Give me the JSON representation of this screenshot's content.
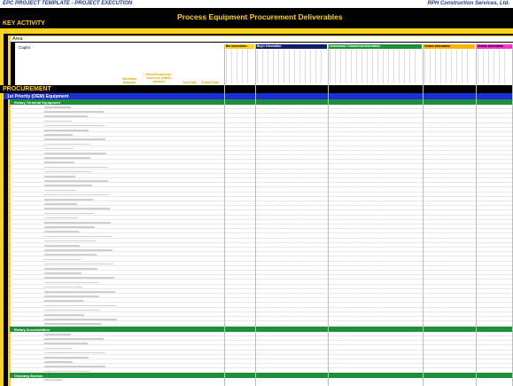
{
  "header": {
    "left_title": "EPC PROJECT TEMPLATE - PROJECT EXECUTION",
    "company": "RPH Construction Services, Ltd.",
    "main_title": "Process Equipment Procurement Deliverables",
    "key_activity": "KEY ACTIVITY"
  },
  "labels": {
    "area": "Area",
    "capex": "CapEx",
    "workflow_diagram": "Workflow Diagram",
    "wbs_amount": "Work Breakdown Structure (WBS) Amount",
    "due_date": "Due Date",
    "actual_date": "Actual Date"
  },
  "groups": [
    {
      "label": "Bid Information",
      "color": "#ffd11a",
      "text_color": "#000000"
    },
    {
      "label": "Buyer Information",
      "color": "#111e66",
      "text_color": "#ffffff"
    },
    {
      "label": "Contractual / Commercial Information",
      "color": "#1e8f3a",
      "text_color": "#ffffff"
    },
    {
      "label": "Vendor Information",
      "color": "#ffb400",
      "text_color": "#000000"
    },
    {
      "label": "Vendor Information",
      "color": "#ff33cc",
      "text_color": "#000000"
    }
  ],
  "procurement": {
    "label": "PROCUREMENT",
    "priority_label": "1st Priority (OEM) Equipment",
    "section1": "Rotary Terminal Equipment",
    "section2": "Rotary Accumulation",
    "section3": "Cleaning Section",
    "section3_row": "Cleaning system"
  },
  "colors": {
    "black": "#000000",
    "yellow": "#ffd11a",
    "blue": "#1c2fd6",
    "green": "#1e8f3a"
  }
}
